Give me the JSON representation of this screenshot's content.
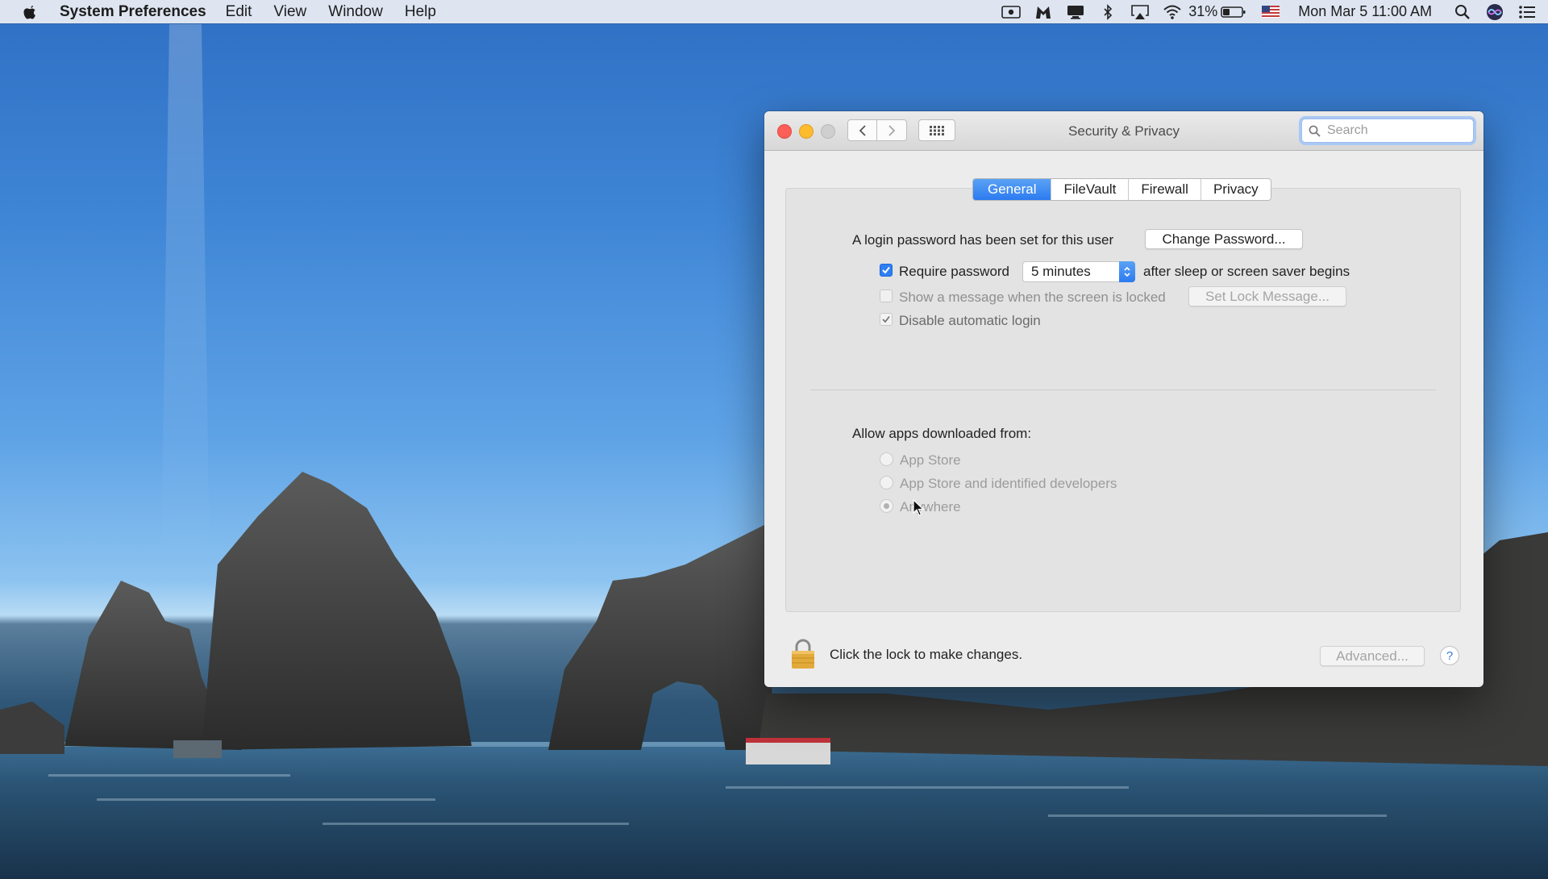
{
  "menubar": {
    "app_name": "System Preferences",
    "menus": [
      "Edit",
      "View",
      "Window",
      "Help"
    ],
    "battery_percent": "31%",
    "clock": "Mon Mar 5  11:00 AM"
  },
  "window": {
    "title": "Security & Privacy",
    "search_placeholder": "Search",
    "tabs": [
      {
        "label": "General",
        "active": true
      },
      {
        "label": "FileVault",
        "active": false
      },
      {
        "label": "Firewall",
        "active": false
      },
      {
        "label": "Privacy",
        "active": false
      }
    ],
    "general": {
      "login_text": "A login password has been set for this user",
      "change_password_label": "Change Password...",
      "require_password": {
        "label": "Require password",
        "checked": true
      },
      "require_delay": "5 minutes",
      "after_sleep_text": "after sleep or screen saver begins",
      "show_message": {
        "label": "Show a message when the screen is locked",
        "checked": false
      },
      "set_lock_message_label": "Set Lock Message...",
      "disable_auto_login": {
        "label": "Disable automatic login",
        "checked": true
      },
      "allow_apps_heading": "Allow apps downloaded from:",
      "allow_options": [
        {
          "label": "App Store",
          "selected": false
        },
        {
          "label": "App Store and identified developers",
          "selected": false
        },
        {
          "label": "Anywhere",
          "selected": true
        }
      ]
    },
    "footer": {
      "lock_text": "Click the lock to make changes.",
      "advanced_label": "Advanced...",
      "help_label": "?"
    }
  },
  "colors": {
    "accent": "#2f7ff2",
    "close": "#fc5f57",
    "minimize": "#fdbc2e"
  }
}
